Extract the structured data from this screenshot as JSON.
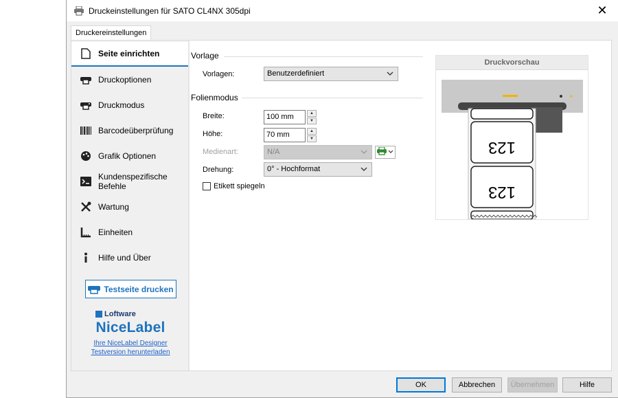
{
  "window": {
    "title": "Druckeinstellungen für SATO CL4NX 305dpi",
    "close_symbol": "✕",
    "icon": "printer-icon"
  },
  "tab": {
    "label": "Druckereinstellungen"
  },
  "sidebar": {
    "items": [
      {
        "label": "Seite einrichten",
        "icon": "page-icon",
        "active": true
      },
      {
        "label": "Druckoptionen",
        "icon": "printer-icon"
      },
      {
        "label": "Druckmodus",
        "icon": "printer-mode-icon"
      },
      {
        "label": "Barcodeüberprüfung",
        "icon": "barcode-icon"
      },
      {
        "label": "Grafik Optionen",
        "icon": "palette-icon"
      },
      {
        "label": "Kundenspezifische Befehle",
        "icon": "terminal-icon"
      },
      {
        "label": "Wartung",
        "icon": "tools-icon"
      },
      {
        "label": "Einheiten",
        "icon": "ruler-icon"
      },
      {
        "label": "Hilfe und Über",
        "icon": "info-icon"
      }
    ],
    "test_button": "Testseite drucken",
    "brand": {
      "company": "Loftware",
      "product": "NiceLabel",
      "link_line1": "Ihre NiceLabel Designer",
      "link_line2": "Testversion herunterladen"
    }
  },
  "vorlage": {
    "section": "Vorlage",
    "label": "Vorlagen:",
    "value": "Benutzerdefiniert"
  },
  "folienmodus": {
    "section": "Folienmodus",
    "breite_label": "Breite:",
    "breite_value": "100 mm",
    "hoehe_label": "Höhe:",
    "hoehe_value": "70 mm",
    "medienart_label": "Medienart:",
    "medienart_value": "N/A",
    "drehung_label": "Drehung:",
    "drehung_value": "0° - Hochformat",
    "spiegeln_label": "Etikett spiegeln",
    "spiegeln_checked": false
  },
  "preview": {
    "title": "Druckvorschau",
    "label_text": "123"
  },
  "footer": {
    "ok": "OK",
    "cancel": "Abbrechen",
    "apply": "Übernehmen",
    "help": "Hilfe"
  },
  "colors": {
    "accent": "#1e73be",
    "link": "#1e62c8",
    "printer_green": "#2e8b2e",
    "indicator_yellow": "#f0b400"
  }
}
